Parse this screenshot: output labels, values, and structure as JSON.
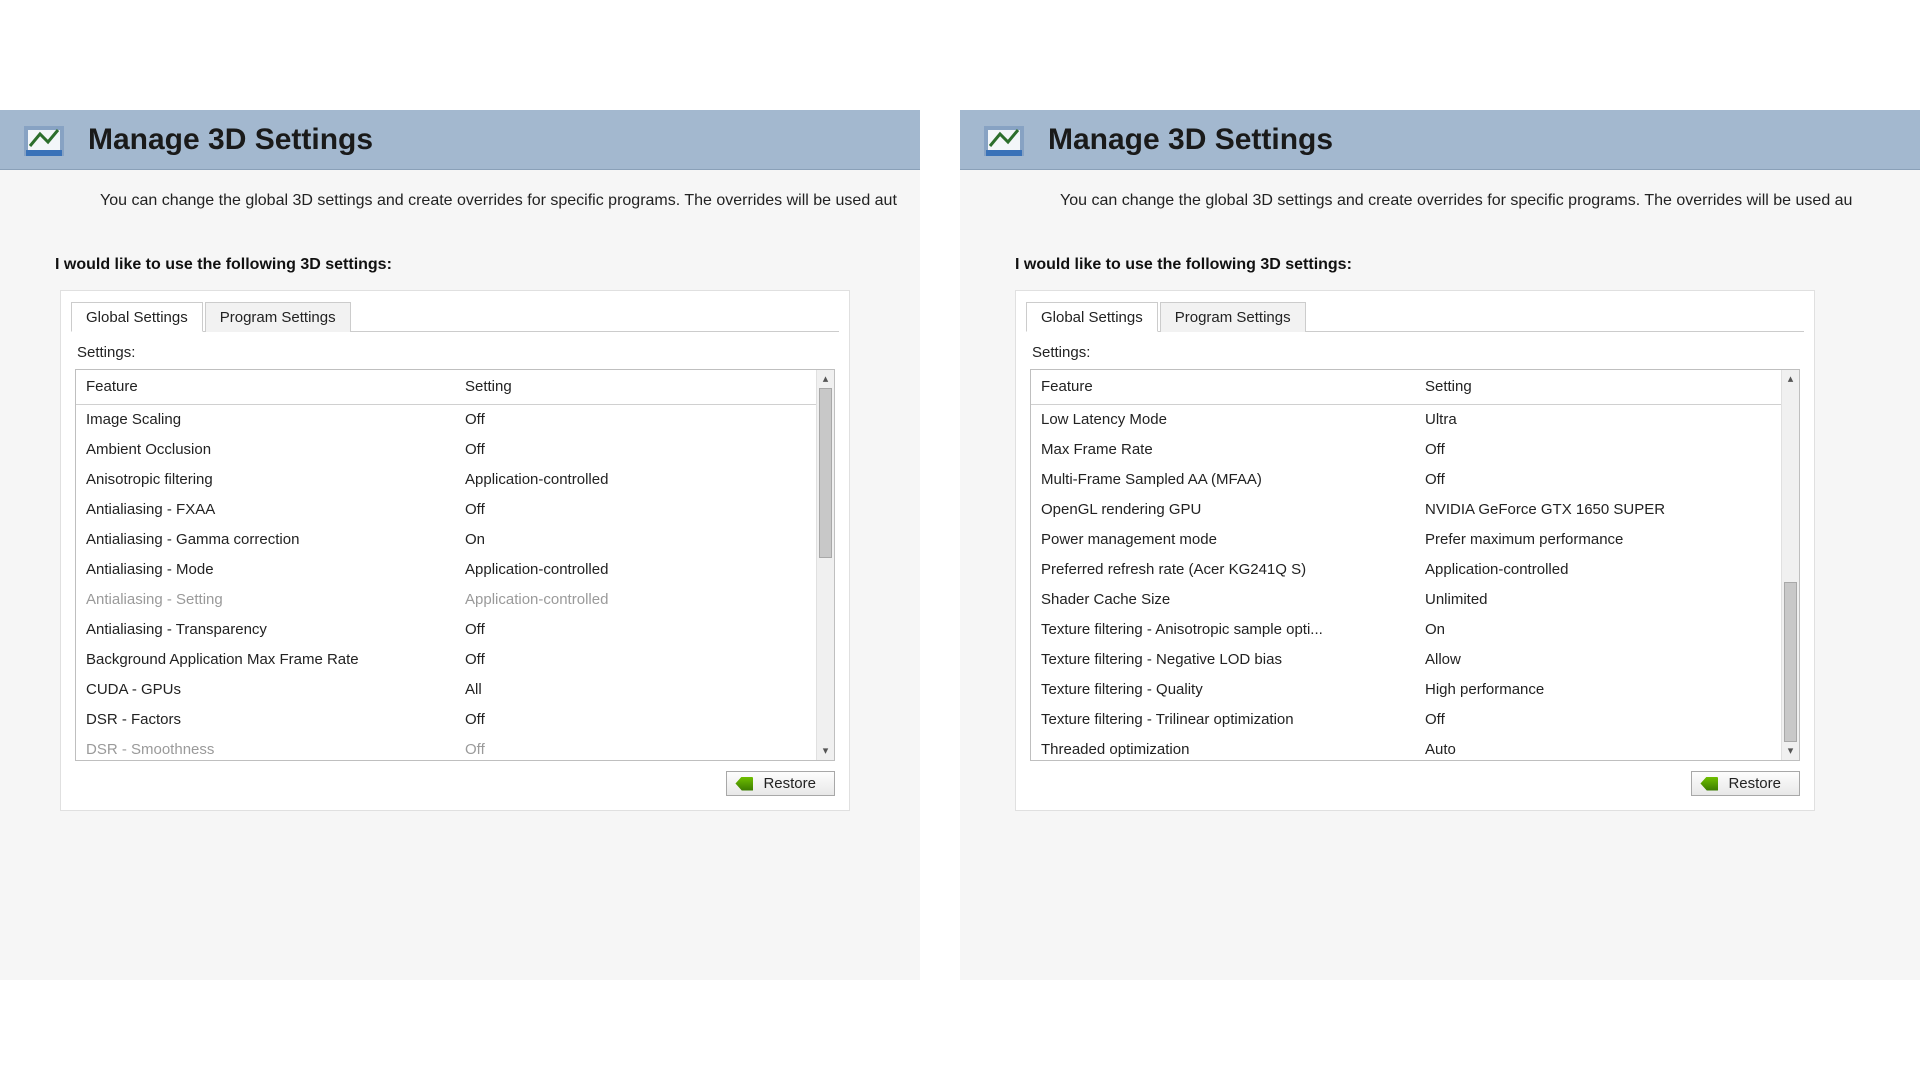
{
  "header_title": "Manage 3D Settings",
  "description": "You can change the global 3D settings and create overrides for specific programs. The overrides will be used aut",
  "description_right": "You can change the global 3D settings and create overrides for specific programs. The overrides will be used au",
  "section_label": "I would like to use the following 3D settings:",
  "tabs": {
    "global": "Global Settings",
    "program": "Program Settings",
    "active": 0
  },
  "settings_label": "Settings:",
  "table_headers": {
    "feature": "Feature",
    "setting": "Setting"
  },
  "restore_label": "Restore",
  "left_rows": [
    {
      "feature": "Image Scaling",
      "setting": "Off",
      "disabled": false
    },
    {
      "feature": "Ambient Occlusion",
      "setting": "Off",
      "disabled": false
    },
    {
      "feature": "Anisotropic filtering",
      "setting": "Application-controlled",
      "disabled": false
    },
    {
      "feature": "Antialiasing - FXAA",
      "setting": "Off",
      "disabled": false
    },
    {
      "feature": "Antialiasing - Gamma correction",
      "setting": "On",
      "disabled": false
    },
    {
      "feature": "Antialiasing - Mode",
      "setting": "Application-controlled",
      "disabled": false
    },
    {
      "feature": "Antialiasing - Setting",
      "setting": "Application-controlled",
      "disabled": true
    },
    {
      "feature": "Antialiasing - Transparency",
      "setting": "Off",
      "disabled": false
    },
    {
      "feature": "Background Application Max Frame Rate",
      "setting": "Off",
      "disabled": false
    },
    {
      "feature": "CUDA - GPUs",
      "setting": "All",
      "disabled": false
    },
    {
      "feature": "DSR - Factors",
      "setting": "Off",
      "disabled": false
    },
    {
      "feature": "DSR - Smoothness",
      "setting": "Off",
      "disabled": true
    }
  ],
  "right_rows": [
    {
      "feature": "Low Latency Mode",
      "setting": "Ultra",
      "disabled": false
    },
    {
      "feature": "Max Frame Rate",
      "setting": "Off",
      "disabled": false
    },
    {
      "feature": "Multi-Frame Sampled AA (MFAA)",
      "setting": "Off",
      "disabled": false
    },
    {
      "feature": "OpenGL rendering GPU",
      "setting": "NVIDIA GeForce GTX 1650 SUPER",
      "disabled": false
    },
    {
      "feature": "Power management mode",
      "setting": "Prefer maximum performance",
      "disabled": false
    },
    {
      "feature": "Preferred refresh rate (Acer KG241Q S)",
      "setting": "Application-controlled",
      "disabled": false
    },
    {
      "feature": "Shader Cache Size",
      "setting": "Unlimited",
      "disabled": false
    },
    {
      "feature": "Texture filtering - Anisotropic sample opti...",
      "setting": "On",
      "disabled": false
    },
    {
      "feature": "Texture filtering - Negative LOD bias",
      "setting": "Allow",
      "disabled": false
    },
    {
      "feature": "Texture filtering - Quality",
      "setting": "High performance",
      "disabled": false
    },
    {
      "feature": "Texture filtering - Trilinear optimization",
      "setting": "Off",
      "disabled": false
    },
    {
      "feature": "Threaded optimization",
      "setting": "Auto",
      "disabled": false
    }
  ]
}
